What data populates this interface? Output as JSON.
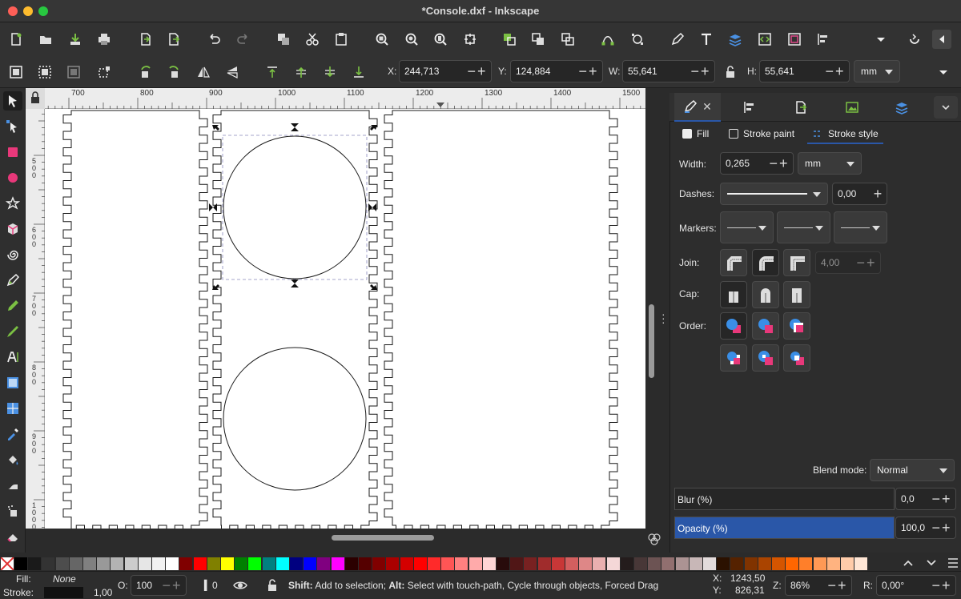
{
  "window": {
    "title": "*Console.dxf - Inkscape"
  },
  "toolbar_main": {
    "icons": [
      "new-document",
      "open-file",
      "import",
      "print",
      "export",
      "export-pdf",
      "undo",
      "redo",
      "duplicate",
      "cut",
      "paste",
      "zoom-selection",
      "zoom-drawing",
      "zoom-page",
      "zoom-fit",
      "group",
      "ungroup",
      "enter-group",
      "node",
      "object-to-path",
      "pen-tool",
      "text",
      "layers",
      "xml-editor",
      "document-properties",
      "align-distribute",
      "more-dropdown",
      "snap",
      "sidebar-toggle"
    ]
  },
  "toolbar_select": {
    "x_label": "X:",
    "x_value": "244,713",
    "y_label": "Y:",
    "y_value": "124,884",
    "w_label": "W:",
    "w_value": "55,641",
    "h_label": "H:",
    "h_value": "55,641",
    "unit": "mm",
    "pm": "−+"
  },
  "ruler": {
    "h_labels": [
      "700",
      "800",
      "900",
      "1000",
      "1100",
      "1200",
      "1300",
      "1400",
      "1500"
    ],
    "v_labels": [
      "5\n0\n0",
      "6\n0\n0",
      "7\n0\n0",
      "8\n0\n0",
      "9\n0\n0",
      "1\n0\n0\n0"
    ]
  },
  "panel": {
    "tabs": [
      "fill-stroke",
      "align",
      "export",
      "image",
      "layers"
    ],
    "subtabs": {
      "fill": "Fill",
      "stroke_paint": "Stroke paint",
      "stroke_style": "Stroke style"
    },
    "width_label": "Width:",
    "width_value": "0,265",
    "width_unit": "mm",
    "dashes_label": "Dashes:",
    "dash_offset": "0,00",
    "markers_label": "Markers:",
    "join_label": "Join:",
    "miter_value": "4,00",
    "cap_label": "Cap:",
    "order_label": "Order:",
    "blend_label": "Blend mode:",
    "blend_value": "Normal",
    "blur_label": "Blur (%)",
    "blur_value": "0,0",
    "opacity_label": "Opacity (%)",
    "opacity_value": "100,0",
    "accent": "#2a57a8"
  },
  "palette": {
    "colors": [
      "#000000",
      "#1a1a1a",
      "#333333",
      "#4d4d4d",
      "#666666",
      "#808080",
      "#999999",
      "#b3b3b3",
      "#cccccc",
      "#e6e6e6",
      "#f2f2f2",
      "#ffffff",
      "#800000",
      "#ff0000",
      "#808000",
      "#ffff00",
      "#008000",
      "#00ff00",
      "#008080",
      "#00ffff",
      "#000080",
      "#0000ff",
      "#800080",
      "#ff00ff",
      "#2b0000",
      "#550000",
      "#800000",
      "#aa0000",
      "#d40000",
      "#ff0000",
      "#ff2a2a",
      "#ff5555",
      "#ff8080",
      "#ffaaaa",
      "#ffd5d5",
      "#280b0b",
      "#501616",
      "#782121",
      "#a02c2c",
      "#c83737",
      "#d35f5f",
      "#de8787",
      "#e9afaf",
      "#f4d7d7",
      "#241c1c",
      "#483737",
      "#6c5353",
      "#916f6f",
      "#ac9393",
      "#c8b7b7",
      "#e3dbdb",
      "#2b1100",
      "#552200",
      "#803300",
      "#aa4400",
      "#d45500",
      "#ff6600",
      "#ff7f2a",
      "#ff9955",
      "#ffb380",
      "#ffccaa",
      "#ffe6d5"
    ]
  },
  "status": {
    "fill_label": "Fill:",
    "fill_value": "None",
    "stroke_label": "Stroke:",
    "stroke_width": "1,00",
    "opacity_label": "O:",
    "opacity_value": "100",
    "layer_value": "0",
    "message_bold1": "Shift:",
    "message1": " Add to selection; ",
    "message_bold2": "Alt:",
    "message2": " Select with touch-path, Cycle through objects, Forced Drag",
    "cursor_x_label": "X:",
    "cursor_x": "1243,50",
    "cursor_y_label": "Y:",
    "cursor_y": "826,31",
    "zoom_label": "Z:",
    "zoom_value": "86%",
    "rotate_label": "R:",
    "rotate_value": "0,00°"
  }
}
